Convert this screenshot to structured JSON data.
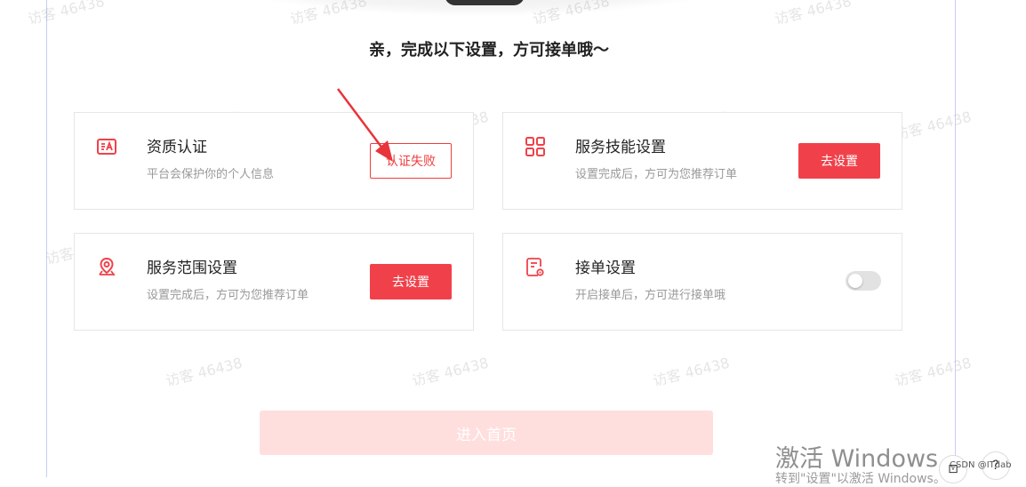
{
  "heading": "亲，完成以下设置，方可接单哦～",
  "watermark": "访客 46438",
  "cards": {
    "qualification": {
      "title": "资质认证",
      "desc": "平台会保护你的个人信息",
      "button": "认证失败",
      "icon": "id-card-icon"
    },
    "skills": {
      "title": "服务技能设置",
      "desc": "设置完成后，方可为您推荐订单",
      "button": "去设置",
      "icon": "grid-icon"
    },
    "range": {
      "title": "服务范围设置",
      "desc": "设置完成后，方可为您推荐订单",
      "button": "去设置",
      "icon": "location-icon"
    },
    "order_accept": {
      "title": "接单设置",
      "desc": "开启接单后，方可进行接单哦",
      "toggle_on": false,
      "icon": "settings-doc-icon"
    }
  },
  "enter_button": "进入首页",
  "windows_activate": "激活 Windows",
  "windows_activate_sub": "转到\"设置\"以激活 Windows。",
  "csdn": "CSDN @ITdab",
  "colors": {
    "accent": "#f0414a",
    "disabled_button": "#ffdede",
    "border": "#e6e6e6"
  }
}
